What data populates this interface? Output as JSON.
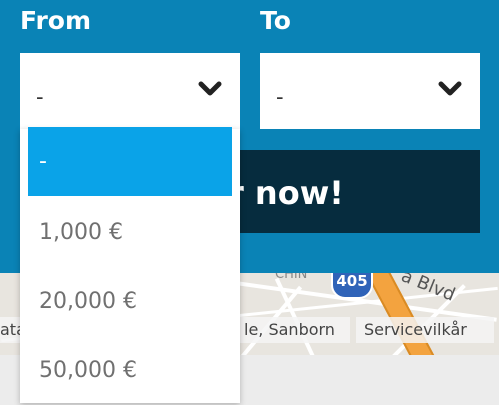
{
  "form": {
    "from_label": "From",
    "to_label": "To",
    "from_select": {
      "value": "-",
      "icon": "chevron-down-icon"
    },
    "to_select": {
      "value": "-",
      "icon": "chevron-down-icon"
    },
    "cta_label": "r now!"
  },
  "dropdown": {
    "options": [
      "-",
      "1,000 €",
      "20,000 €",
      "50,000 €"
    ],
    "selected_index": 0
  },
  "map": {
    "route_shield": "405",
    "street_fragment": "a Blvd",
    "place_fragment": "CHIN",
    "attribution_left": "ata",
    "attribution_middle": "le, Sanborn",
    "attribution_right": "Servicevilkår"
  },
  "colors": {
    "panel": "#0a83b6",
    "cta": "#062c3e",
    "selected_option": "#0aa3e8"
  }
}
